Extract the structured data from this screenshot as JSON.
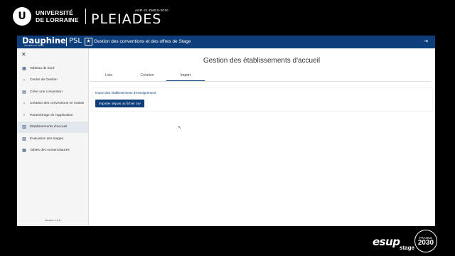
{
  "brand": {
    "university_line1": "UNIVERSITÉ",
    "university_line2": "DE LORRAINE",
    "university_initials": "U",
    "pleiades_code": "ANR-21-DMES-0010",
    "pleiades_name": "PLEIADES"
  },
  "app": {
    "logo_name": "Dauphine",
    "logo_sub": "UNIVERSITÉ PARIS",
    "logo_psl": "PSL",
    "psl_star": "★",
    "title": "Gestion des conventions et des offres de Stage",
    "logout_icon": "⇥"
  },
  "sidebar": {
    "close_icon": "✕",
    "items": [
      {
        "label": "Tableau de bord",
        "icon": "▦",
        "icon_name": "dashboard-icon"
      },
      {
        "label": "Centre de Gestion",
        "icon": "›",
        "icon_name": "chevron-right-icon"
      },
      {
        "label": "Créer une convention",
        "icon": "▤",
        "icon_name": "document-icon"
      },
      {
        "label": "Création des conventions en masse",
        "icon": "›",
        "icon_name": "chevron-right-icon"
      },
      {
        "label": "Paramétrage de l'application",
        "icon": "›",
        "icon_name": "chevron-right-icon"
      },
      {
        "label": "Établissements d'accueil",
        "icon": "▥",
        "icon_name": "building-icon"
      },
      {
        "label": "Évaluation des stages",
        "icon": "▨",
        "icon_name": "evaluation-icon"
      },
      {
        "label": "Tables des nomenclatures",
        "icon": "▦",
        "icon_name": "table-icon"
      }
    ],
    "active_index": 5,
    "version": "Version 1.0.6"
  },
  "main": {
    "title": "Gestion des établissements d'accueil",
    "tabs": [
      "Liste",
      "Création",
      "Import"
    ],
    "active_tab": 2,
    "import_label": "Import des établissements d'enseignement",
    "import_button": "Importer depuis un fichier csv"
  },
  "footer": {
    "esup": "esup",
    "esup_stage": "stage",
    "france_top": "FRANCE",
    "france_year": "2030"
  },
  "colors": {
    "header": "#0d3d7a",
    "active_item": "#e3e7ee"
  }
}
